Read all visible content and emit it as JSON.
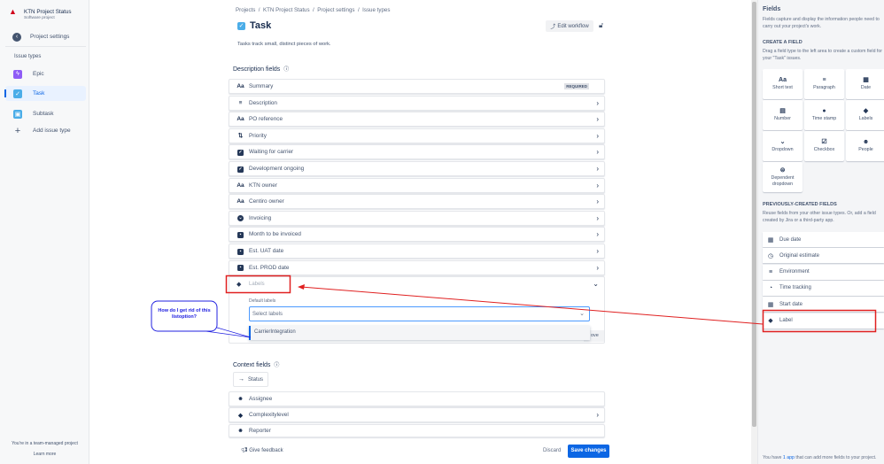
{
  "sidebar": {
    "project_name": "KTN Project Status",
    "project_type": "Software project",
    "back_label": "Project settings",
    "section": "Issue types",
    "items": [
      {
        "label": "Epic",
        "color": "#8f5cf6"
      },
      {
        "label": "Task",
        "color": "#4bade8"
      },
      {
        "label": "Subtask",
        "color": "#4bade8"
      }
    ],
    "add_label": "Add issue type",
    "footer_text": "You're in a team-managed project",
    "learn_more": "Learn more"
  },
  "breadcrumb": [
    "Projects",
    "KTN Project Status",
    "Project settings",
    "Issue types"
  ],
  "page": {
    "title": "Task",
    "description": "Tasks track small, distinct pieces of work.",
    "edit_workflow": "Edit workflow"
  },
  "description_fields": {
    "title": "Description fields",
    "required_badge": "REQUIRED",
    "rows": [
      {
        "label": "Summary",
        "icon": "Aa"
      },
      {
        "label": "Description",
        "icon": "≡"
      },
      {
        "label": "PO reference",
        "icon": "Aa"
      },
      {
        "label": "Priority",
        "icon": "⇅"
      },
      {
        "label": "Waiting for carrier",
        "icon": "checkbox"
      },
      {
        "label": "Development ongoing",
        "icon": "checkbox"
      },
      {
        "label": "KTN owner",
        "icon": "Aa"
      },
      {
        "label": "Centiro owner",
        "icon": "Aa"
      },
      {
        "label": "Invoicing",
        "icon": "dropdown"
      },
      {
        "label": "Month to be invoiced",
        "icon": "date"
      },
      {
        "label": "Est. UAT date",
        "icon": "date"
      },
      {
        "label": "Est. PROD date",
        "icon": "date"
      }
    ],
    "expanded": {
      "label": "Labels",
      "default_labels": "Default labels",
      "placeholder": "Select labels",
      "option": "CarrierIntegration",
      "remove_partial": "ove"
    }
  },
  "context_fields": {
    "title": "Context fields",
    "status": "Status",
    "rows": [
      {
        "label": "Assignee"
      },
      {
        "label": "Complexitylevel"
      },
      {
        "label": "Reporter"
      }
    ]
  },
  "footer": {
    "feedback": "Give feedback",
    "discard": "Discard",
    "save": "Save changes"
  },
  "right_panel": {
    "title": "Fields",
    "desc": "Fields capture and display the information people need to carry out your project's work.",
    "create_heading": "CREATE A FIELD",
    "create_desc": "Drag a field type to the left area to create a custom field for your \"Task\" issues.",
    "tiles": [
      {
        "label": "Short text",
        "icon": "Aa"
      },
      {
        "label": "Paragraph",
        "icon": "≡"
      },
      {
        "label": "Date",
        "icon": "▦"
      },
      {
        "label": "Number",
        "icon": "▤"
      },
      {
        "label": "Time stamp",
        "icon": "●"
      },
      {
        "label": "Labels",
        "icon": "◆"
      },
      {
        "label": "Dropdown",
        "icon": "⌄"
      },
      {
        "label": "Checkbox",
        "icon": "☑"
      },
      {
        "label": "People",
        "icon": "☻"
      },
      {
        "label": "Dependent dropdown",
        "icon": "⊜"
      }
    ],
    "prev_heading": "PREVIOUSLY-CREATED FIELDS",
    "prev_desc": "Reuse fields from your other issue types. Or, add a field created by Jira or a third-party app.",
    "prev": [
      {
        "label": "Due date",
        "icon": "▦"
      },
      {
        "label": "Original estimate",
        "icon": "◷"
      },
      {
        "label": "Environment",
        "icon": "≡"
      },
      {
        "label": "Time tracking",
        "icon": "◔"
      },
      {
        "label": "Start date",
        "icon": "▦"
      },
      {
        "label": "Label",
        "icon": "◆"
      }
    ],
    "footer_pre": "You have ",
    "footer_link": "1 app",
    "footer_post": " that can add more fields to your project."
  },
  "annotation": {
    "callout": "How do I get rid of this listoption?"
  },
  "colors": {
    "accent": "#0c66e4",
    "annotation_red": "#e02020",
    "callout_blue": "#2020e0"
  }
}
